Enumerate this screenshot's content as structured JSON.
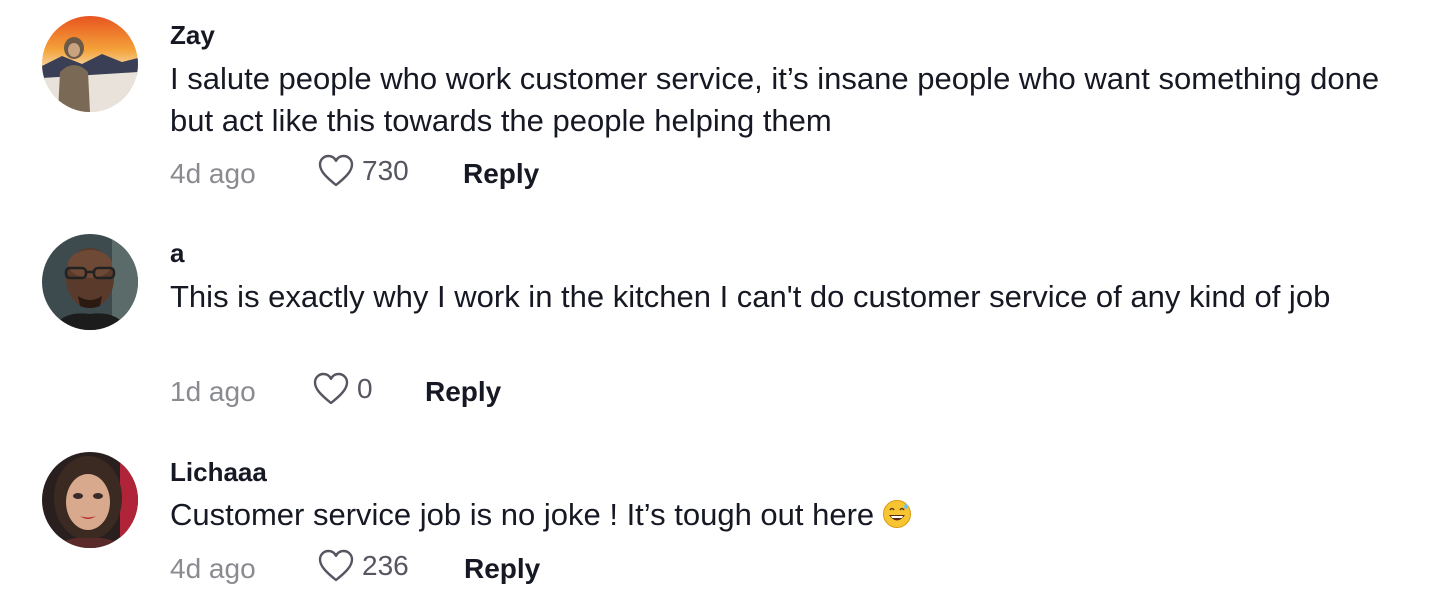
{
  "comments": [
    {
      "username": "Zay",
      "text": "I salute people who work customer service, it’s insane people who want something done but act like this towards the people helping them",
      "time": "4d ago",
      "likes": "730",
      "reply_label": "Reply"
    },
    {
      "username": "a",
      "text": "This is exactly why I work in the kitchen I can't do customer service of any kind of job",
      "time": "1d ago",
      "likes": "0",
      "reply_label": "Reply"
    },
    {
      "username": "Lichaaa",
      "text": "Customer service job is no joke ! It’s tough out here",
      "emoji": "grinning-sweat-emoji",
      "time": "4d ago",
      "likes": "236",
      "reply_label": "Reply"
    }
  ],
  "icons": {
    "like": "heart-outline-icon"
  },
  "colors": {
    "text": "#161823",
    "muted": "#8a8b91",
    "background": "#ffffff"
  }
}
